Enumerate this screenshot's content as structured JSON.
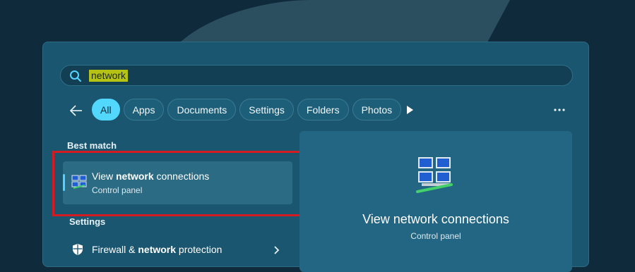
{
  "search": {
    "query": "network"
  },
  "filters": [
    "All",
    "Apps",
    "Documents",
    "Settings",
    "Folders",
    "Photos"
  ],
  "sections": {
    "best_match": "Best match",
    "settings": "Settings"
  },
  "best_result": {
    "title_prefix": "View ",
    "title_bold": "network",
    "title_suffix": " connections",
    "subtitle": "Control panel"
  },
  "setting_result": {
    "prefix": "Firewall & ",
    "bold": "network",
    "suffix": " protection"
  },
  "preview": {
    "title": "View network connections",
    "subtitle": "Control panel"
  },
  "colors": {
    "accent": "#52d8ff",
    "highlight_box": "#d41b22",
    "search_highlight": "#b6c315"
  }
}
